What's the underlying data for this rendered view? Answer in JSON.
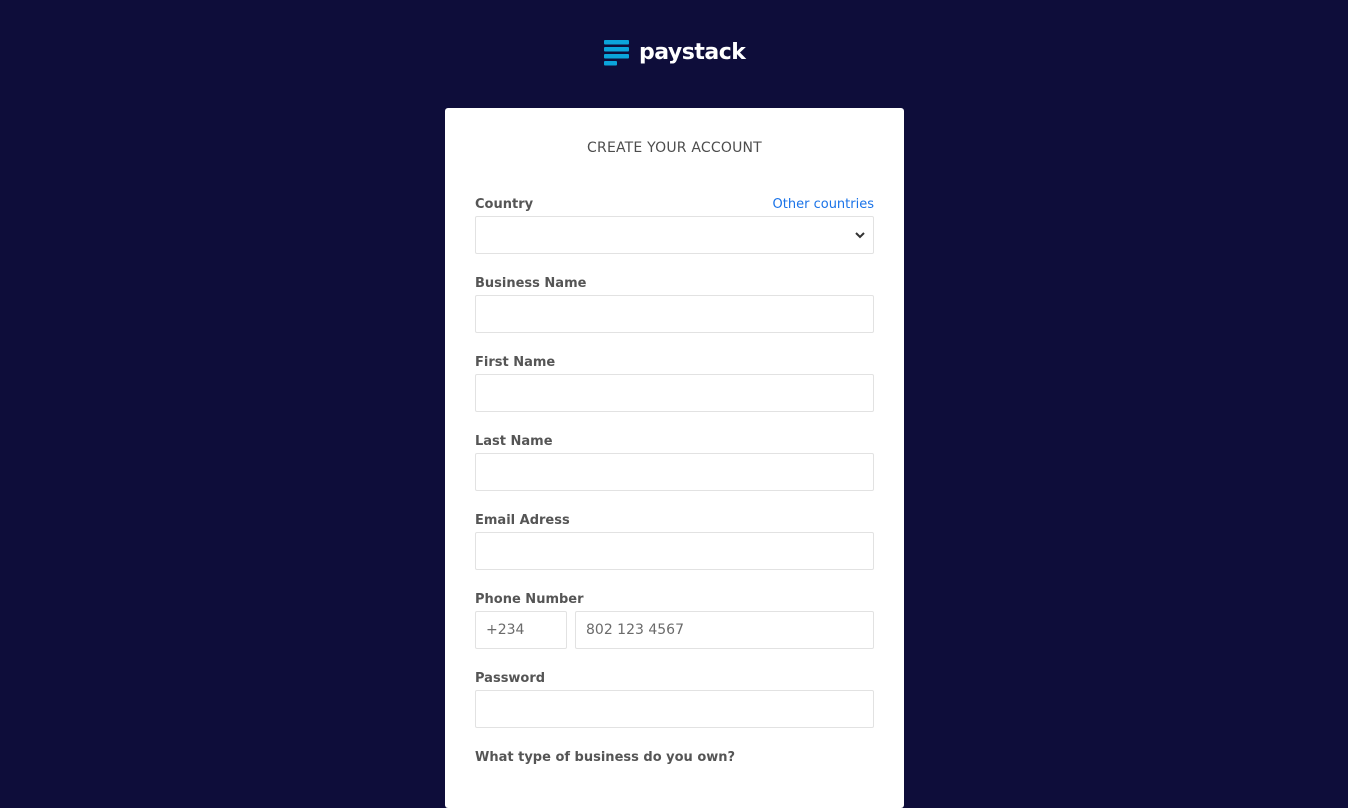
{
  "brand": {
    "name": "paystack",
    "accent": "#0ba4db",
    "background": "#0e0d3a"
  },
  "form": {
    "title": "CREATE YOUR ACCOUNT",
    "country": {
      "label": "Country",
      "link": "Other countries",
      "value": ""
    },
    "business_name": {
      "label": "Business Name",
      "value": ""
    },
    "first_name": {
      "label": "First Name",
      "value": ""
    },
    "last_name": {
      "label": "Last Name",
      "value": ""
    },
    "email": {
      "label": "Email Adress",
      "value": ""
    },
    "phone": {
      "label": "Phone Number",
      "code": "+234",
      "placeholder": "802 123 4567"
    },
    "password": {
      "label": "Password",
      "value": ""
    },
    "business_type": {
      "label": "What type of business do you own?"
    }
  }
}
